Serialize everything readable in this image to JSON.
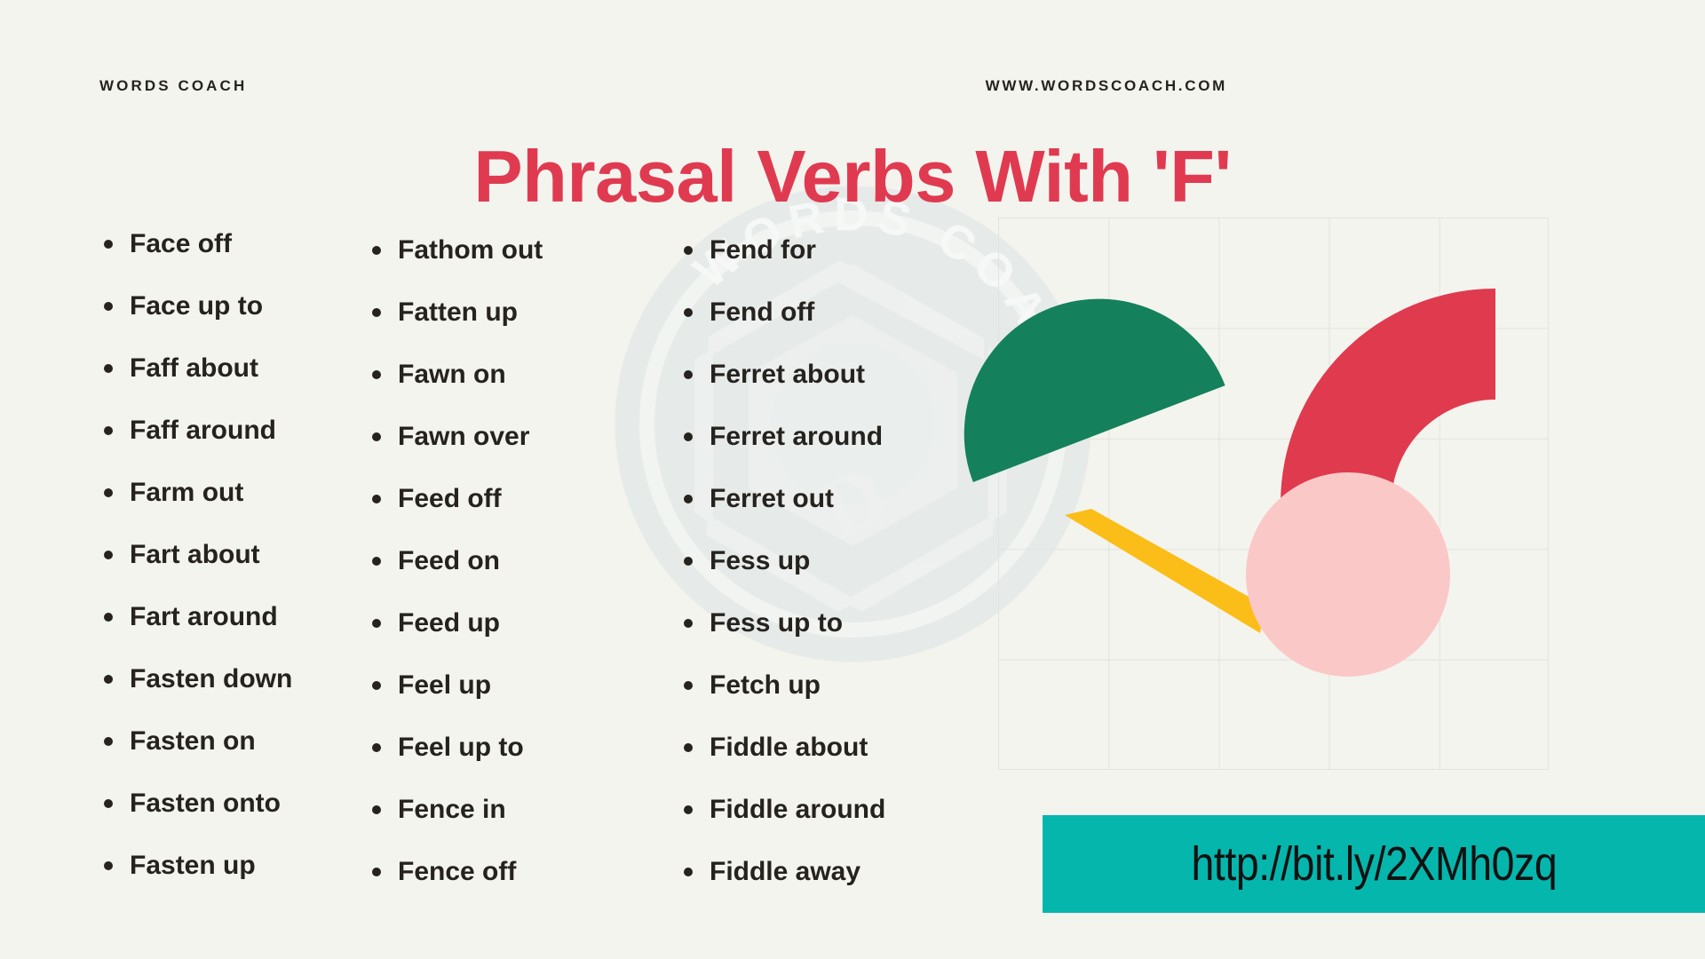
{
  "header": {
    "brand": "WORDS COACH",
    "site_url": "WWW.WORDSCOACH.COM"
  },
  "title": "Phrasal Verbs With 'F'",
  "columns": [
    {
      "items": [
        "Face off",
        "Face up to",
        "Faff about",
        "Faff around",
        "Farm out",
        "Fart about",
        "Fart around",
        "Fasten down",
        "Fasten on",
        "Fasten onto",
        "Fasten up"
      ]
    },
    {
      "items": [
        "Fathom out",
        "Fatten up",
        "Fawn on",
        "Fawn over",
        "Feed off",
        "Feed on",
        "Feed up",
        "Feel up",
        "Feel up to",
        "Fence in",
        "Fence off"
      ]
    },
    {
      "items": [
        "Fend for",
        "Fend off",
        "Ferret about",
        "Ferret around",
        "Ferret out",
        "Fess up",
        "Fess up to",
        "Fetch up",
        "Fiddle about",
        "Fiddle around",
        "Fiddle away"
      ]
    }
  ],
  "banner": {
    "url": "http://bit.ly/2XMh0zq"
  },
  "watermark": {
    "text": "WORDS COACH"
  },
  "colors": {
    "background": "#f4f4ee",
    "title_red": "#e03a51",
    "text_dark": "#26231f",
    "banner_teal": "#05b6ad",
    "shape_green": "#15805c",
    "shape_red": "#e03a4f",
    "shape_yellow": "#fbbd18",
    "shape_pink": "#fbc8c8",
    "grid_line": "#e2e3de",
    "watermark": "#e3e7e6"
  }
}
